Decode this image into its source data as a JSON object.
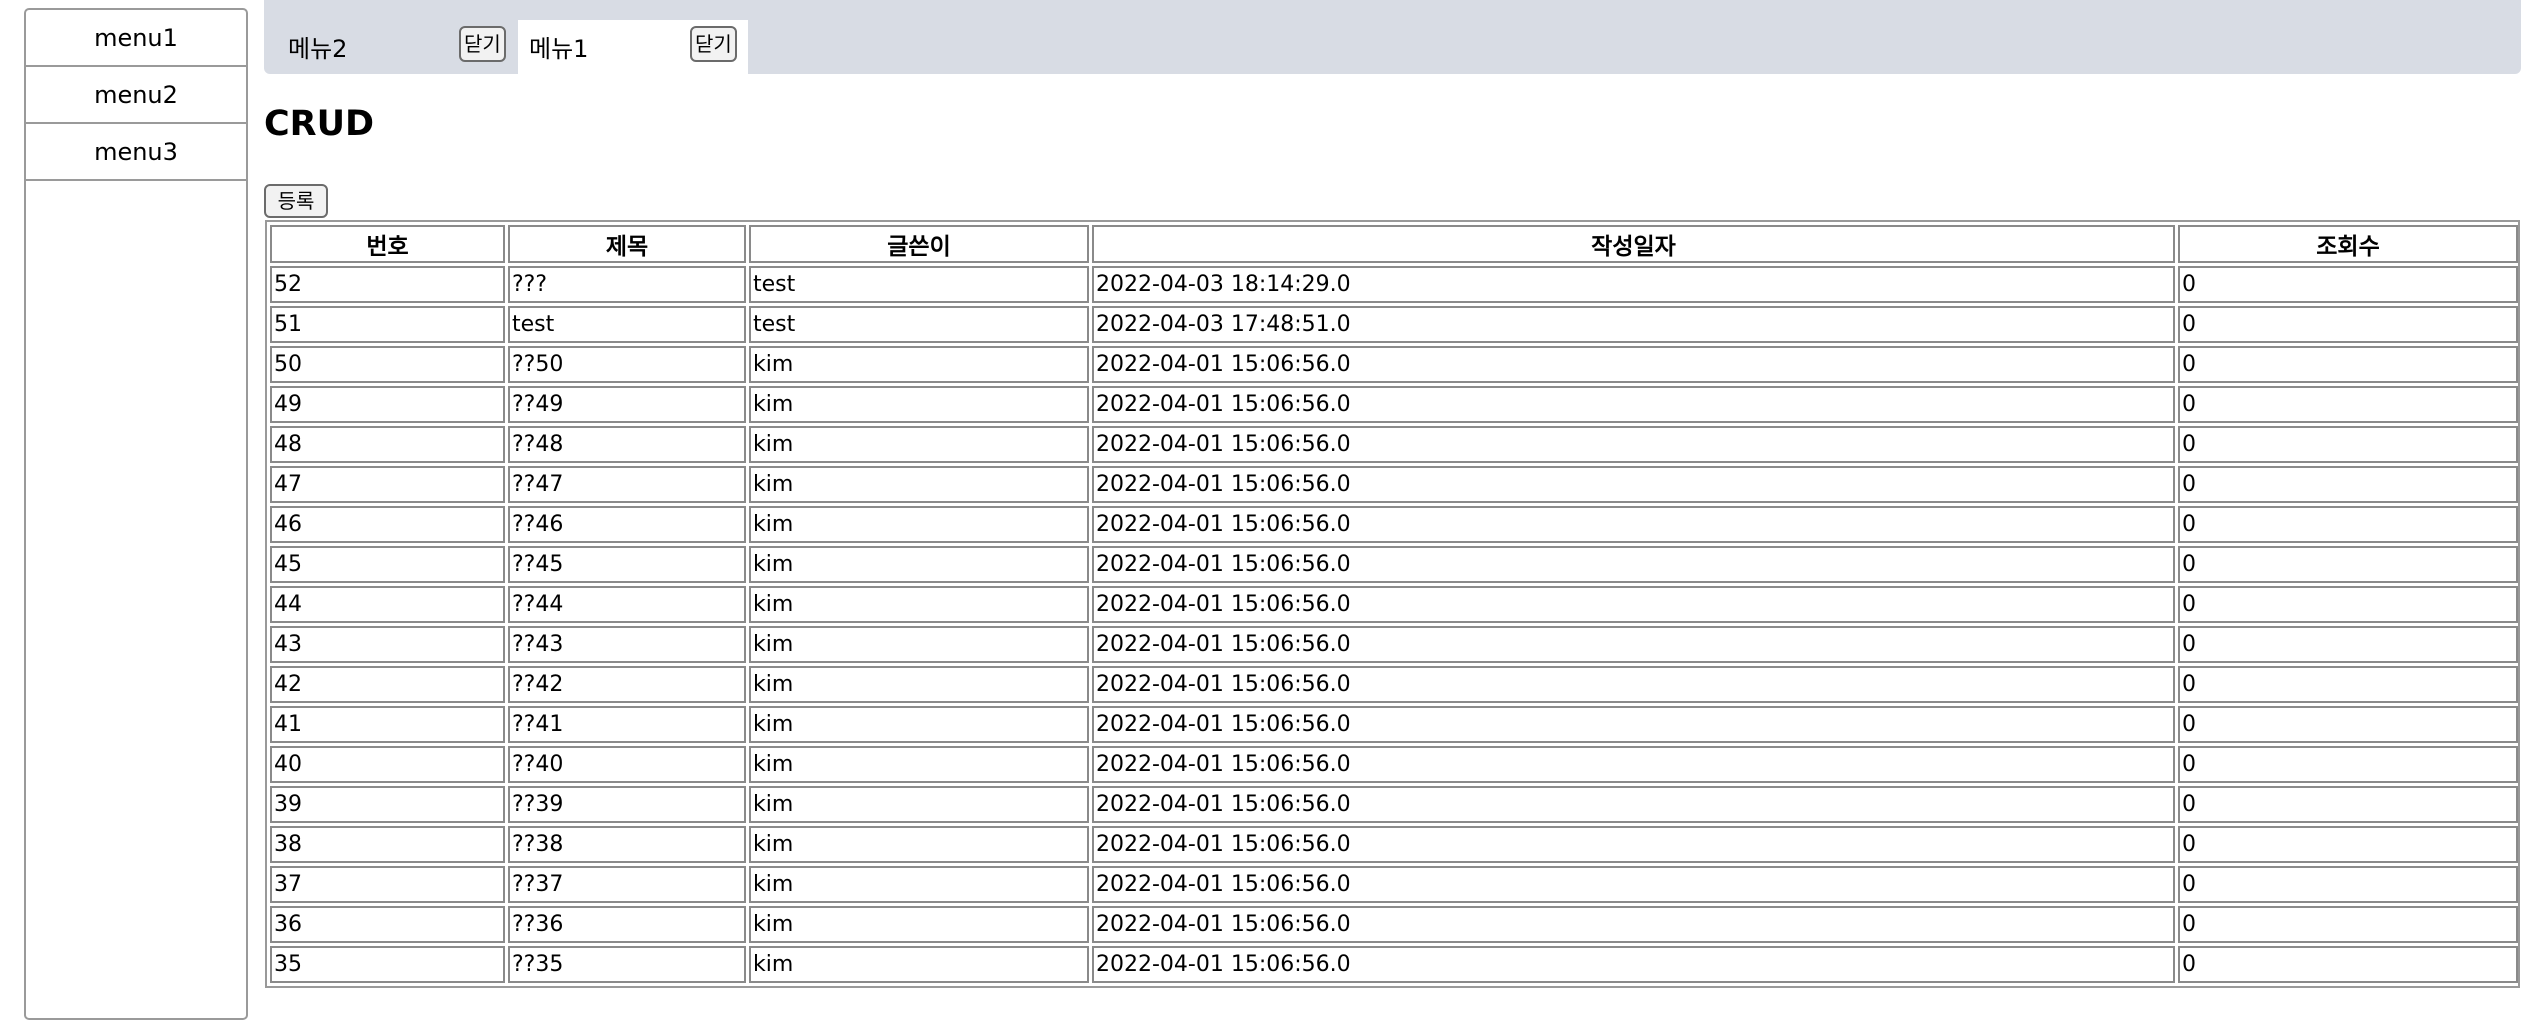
{
  "sidebar": {
    "items": [
      {
        "label": "menu1"
      },
      {
        "label": "menu2"
      },
      {
        "label": "menu3"
      }
    ]
  },
  "tabs": [
    {
      "label": "메뉴2",
      "close_label": "닫기",
      "active": false
    },
    {
      "label": "메뉴1",
      "close_label": "닫기",
      "active": true
    }
  ],
  "page": {
    "title": "CRUD",
    "register_label": "등록"
  },
  "table": {
    "headers": [
      "번호",
      "제목",
      "글쓴이",
      "작성일자",
      "조회수"
    ],
    "rows": [
      [
        "52",
        "???",
        "test",
        "2022-04-03 18:14:29.0",
        "0"
      ],
      [
        "51",
        "test",
        "test",
        "2022-04-03 17:48:51.0",
        "0"
      ],
      [
        "50",
        "??50",
        "kim",
        "2022-04-01 15:06:56.0",
        "0"
      ],
      [
        "49",
        "??49",
        "kim",
        "2022-04-01 15:06:56.0",
        "0"
      ],
      [
        "48",
        "??48",
        "kim",
        "2022-04-01 15:06:56.0",
        "0"
      ],
      [
        "47",
        "??47",
        "kim",
        "2022-04-01 15:06:56.0",
        "0"
      ],
      [
        "46",
        "??46",
        "kim",
        "2022-04-01 15:06:56.0",
        "0"
      ],
      [
        "45",
        "??45",
        "kim",
        "2022-04-01 15:06:56.0",
        "0"
      ],
      [
        "44",
        "??44",
        "kim",
        "2022-04-01 15:06:56.0",
        "0"
      ],
      [
        "43",
        "??43",
        "kim",
        "2022-04-01 15:06:56.0",
        "0"
      ],
      [
        "42",
        "??42",
        "kim",
        "2022-04-01 15:06:56.0",
        "0"
      ],
      [
        "41",
        "??41",
        "kim",
        "2022-04-01 15:06:56.0",
        "0"
      ],
      [
        "40",
        "??40",
        "kim",
        "2022-04-01 15:06:56.0",
        "0"
      ],
      [
        "39",
        "??39",
        "kim",
        "2022-04-01 15:06:56.0",
        "0"
      ],
      [
        "38",
        "??38",
        "kim",
        "2022-04-01 15:06:56.0",
        "0"
      ],
      [
        "37",
        "??37",
        "kim",
        "2022-04-01 15:06:56.0",
        "0"
      ],
      [
        "36",
        "??36",
        "kim",
        "2022-04-01 15:06:56.0",
        "0"
      ],
      [
        "35",
        "??35",
        "kim",
        "2022-04-01 15:06:56.0",
        "0"
      ]
    ]
  }
}
